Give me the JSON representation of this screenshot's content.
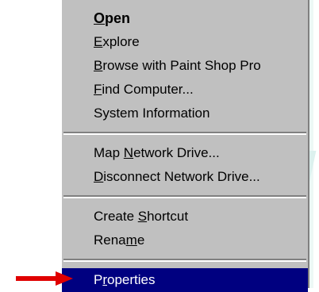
{
  "menu": {
    "items": [
      {
        "pre": "",
        "acc": "O",
        "post": "pen"
      },
      {
        "pre": "",
        "acc": "E",
        "post": "xplore"
      },
      {
        "pre": "",
        "acc": "B",
        "post": "rowse with Paint Shop Pro"
      },
      {
        "pre": "",
        "acc": "F",
        "post": "ind Computer..."
      },
      {
        "pre": "System Information",
        "acc": "",
        "post": ""
      },
      {
        "pre": "Map ",
        "acc": "N",
        "post": "etwork Drive..."
      },
      {
        "pre": "",
        "acc": "D",
        "post": "isconnect Network Drive..."
      },
      {
        "pre": "Create ",
        "acc": "S",
        "post": "hortcut"
      },
      {
        "pre": "Rena",
        "acc": "m",
        "post": "e"
      },
      {
        "pre": "P",
        "acc": "r",
        "post": "operties"
      }
    ]
  },
  "colors": {
    "menu_bg": "#c0c0c0",
    "selection_bg": "#000080",
    "arrow": "#e00000"
  },
  "icons": {
    "pointer": "red-arrow-icon"
  }
}
